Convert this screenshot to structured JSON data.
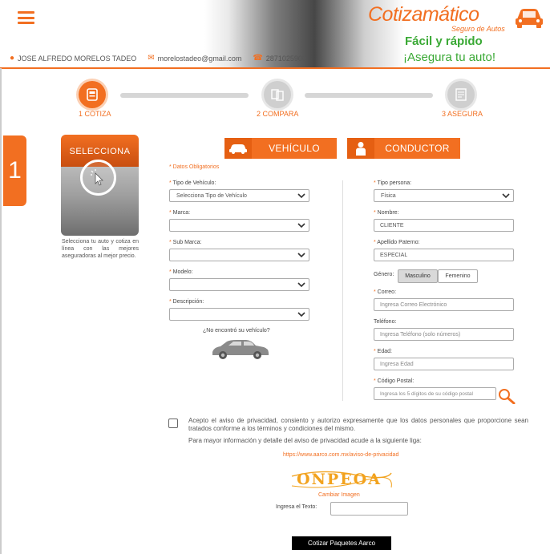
{
  "header": {
    "user_name": "JOSE ALFREDO MORELOS TADEO",
    "email": "morelostadeo@gmail.com",
    "phone": "2871025900",
    "brand_title": "Cotizamático",
    "brand_subtitle": "Seguro de Autos",
    "tagline_1": "Fácil y rápido",
    "tagline_2": "¡Asegura tu auto!",
    "accent_color": "#f26f21",
    "tagline_color": "#3aa935"
  },
  "steps": [
    {
      "label": "1 COTIZA",
      "state": "active",
      "icon": "document-phone-icon"
    },
    {
      "label": "2 COMPARA",
      "state": "inactive",
      "icon": "compare-icon"
    },
    {
      "label": "3 ASEGURA",
      "state": "inactive",
      "icon": "policy-icon"
    }
  ],
  "side_tab": {
    "number": "1"
  },
  "select_card": {
    "title": "SELECCIONA",
    "description": "Selecciona tu auto y cotiza en línea con las mejores aseguradoras al mejor precio."
  },
  "tabs": {
    "vehicle": "VEHÍCULO",
    "driver": "CONDUCTOR"
  },
  "required_note": "* Datos Obligatorios",
  "vehicle_form": {
    "tipo_label": "Tipo de Vehículo:",
    "tipo_value": "Selecciona Tipo de Vehículo",
    "marca_label": "Marca:",
    "marca_value": "",
    "submarca_label": "Sub Marca:",
    "submarca_value": "",
    "modelo_label": "Modelo:",
    "modelo_value": "",
    "descripcion_label": "Descripción:",
    "descripcion_value": "",
    "not_found": "¿No encontró su vehículo?"
  },
  "driver_form": {
    "tipo_persona_label": "Tipo persona:",
    "tipo_persona_value": "Física",
    "nombre_label": "Nombre:",
    "nombre_value": "CLIENTE",
    "apellido_label": "Apellido Paterno:",
    "apellido_value": "ESPECIAL",
    "genero_label": "Género:",
    "genero_masculino": "Masculino",
    "genero_femenino": "Femenino",
    "correo_label": "Correo:",
    "correo_placeholder": "Ingresa Correo Electrónico",
    "telefono_label": "Teléfono:",
    "telefono_placeholder": "Ingresa Teléfono (solo números)",
    "edad_label": "Edad:",
    "edad_placeholder": "Ingresa Edad",
    "cp_label": "Código Postal:",
    "cp_placeholder": "Ingresa los 5 dígitos de su código postal"
  },
  "privacy": {
    "text": "Acepto el aviso de privacidad, consiento y autorizo expresamente que los datos personales que proporcione sean tratados conforme a los términos y condiciones del mismo.",
    "more": "Para mayor información y detalle del aviso de privacidad acude a la siguiente liga:",
    "link": "https://www.aarco.com.mx/aviso-de-privacidad"
  },
  "captcha": {
    "text": "ONPEOA",
    "change": "Cambiar Imagen",
    "input_label": "Ingresa el Texto:"
  },
  "submit_label": "Cotizar Paquetes Aarco"
}
